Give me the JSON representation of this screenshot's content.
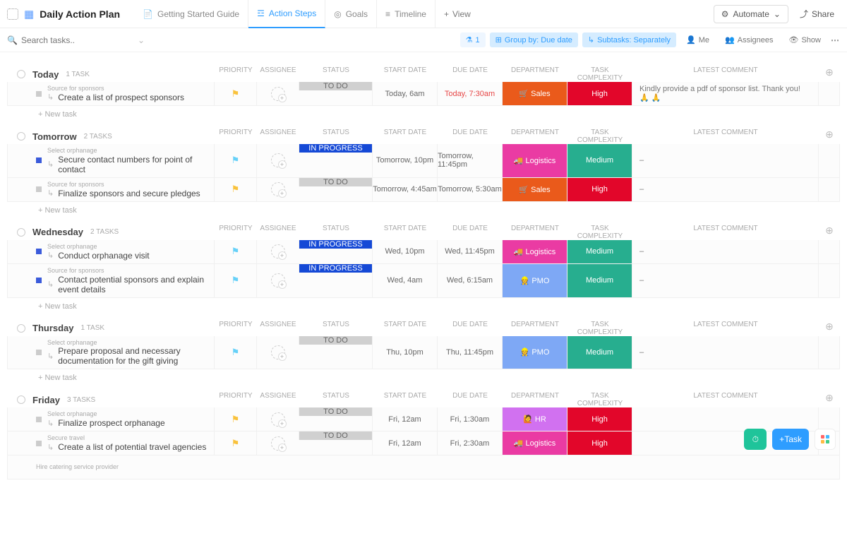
{
  "header": {
    "title": "Daily Action Plan",
    "tabs": [
      "Getting Started Guide",
      "Action Steps",
      "Goals",
      "Timeline"
    ],
    "add_view": "View",
    "automate": "Automate",
    "share": "Share"
  },
  "toolbar": {
    "search_placeholder": "Search tasks..",
    "filter_count": "1",
    "group_by": "Group by: Due date",
    "subtasks": "Subtasks: Separately",
    "me": "Me",
    "assignees": "Assignees",
    "show": "Show"
  },
  "columns": {
    "priority": "PRIORITY",
    "assignee": "ASSIGNEE",
    "status": "STATUS",
    "start": "START DATE",
    "due": "DUE DATE",
    "dept": "DEPARTMENT",
    "cx": "TASK COMPLEXITY",
    "comment": "LATEST COMMENT"
  },
  "new_task": "+ New task",
  "departments": {
    "sales": "🛒 Sales",
    "logistics": "🚚 Logistics",
    "pmo": "👷 PMO",
    "hr": "🙋 HR"
  },
  "complexity": {
    "high": "High",
    "medium": "Medium"
  },
  "status_labels": {
    "todo": "TO DO",
    "progress": "IN PROGRESS"
  },
  "groups": [
    {
      "name": "Today",
      "count": "1 TASK",
      "tasks": [
        {
          "source": "Source for sponsors",
          "name": "Create a list of prospect sponsors",
          "flag": "y",
          "status": "todo",
          "start": "Today, 6am",
          "due": "Today, 7:30am",
          "due_red": true,
          "dept": "sales",
          "cx": "high",
          "comment": "Kindly provide a pdf of sponsor list. Thank you! 🙏 🙏",
          "sq": "g"
        }
      ]
    },
    {
      "name": "Tomorrow",
      "count": "2 TASKS",
      "tasks": [
        {
          "source": "Select orphanage",
          "name": "Secure contact numbers for point of contact",
          "flag": "c",
          "status": "progress",
          "start": "Tomorrow, 10pm",
          "due": "Tomorrow, 11:45pm",
          "dept": "logistics",
          "cx": "medium",
          "comment": "–",
          "sq": "b"
        },
        {
          "source": "Source for sponsors",
          "name": "Finalize sponsors and secure pledges",
          "flag": "y",
          "status": "todo",
          "start": "Tomorrow, 4:45am",
          "due": "Tomorrow, 5:30am",
          "dept": "sales",
          "cx": "high",
          "comment": "–",
          "sq": "g"
        }
      ]
    },
    {
      "name": "Wednesday",
      "count": "2 TASKS",
      "tasks": [
        {
          "source": "Select orphanage",
          "name": "Conduct orphanage visit",
          "flag": "c",
          "status": "progress",
          "start": "Wed, 10pm",
          "due": "Wed, 11:45pm",
          "dept": "logistics",
          "cx": "medium",
          "comment": "–",
          "sq": "b"
        },
        {
          "source": "Source for sponsors",
          "name": "Contact potential sponsors and explain event details",
          "flag": "c",
          "status": "progress",
          "start": "Wed, 4am",
          "due": "Wed, 6:15am",
          "dept": "pmo",
          "cx": "medium",
          "comment": "–",
          "sq": "b"
        }
      ]
    },
    {
      "name": "Thursday",
      "count": "1 TASK",
      "tasks": [
        {
          "source": "Select orphanage",
          "name": "Prepare proposal and necessary documentation for the gift giving",
          "flag": "c",
          "status": "todo",
          "start": "Thu, 10pm",
          "due": "Thu, 11:45pm",
          "dept": "pmo",
          "cx": "medium",
          "comment": "–",
          "sq": "g"
        }
      ]
    },
    {
      "name": "Friday",
      "count": "3 TASKS",
      "tasks": [
        {
          "source": "Select orphanage",
          "name": "Finalize prospect orphanage",
          "flag": "y",
          "status": "todo",
          "start": "Fri, 12am",
          "due": "Fri, 1:30am",
          "dept": "hr",
          "cx": "high",
          "comment": "",
          "sq": "g"
        },
        {
          "source": "Secure travel",
          "name": "Create a list of potential travel agencies",
          "flag": "y",
          "status": "todo",
          "start": "Fri, 12am",
          "due": "Fri, 2:30am",
          "dept": "logistics",
          "cx": "high",
          "comment": "",
          "sq": "g"
        },
        {
          "source": "",
          "name": "Hire catering service provider",
          "bare": true
        }
      ]
    }
  ],
  "float": {
    "task": "Task"
  }
}
